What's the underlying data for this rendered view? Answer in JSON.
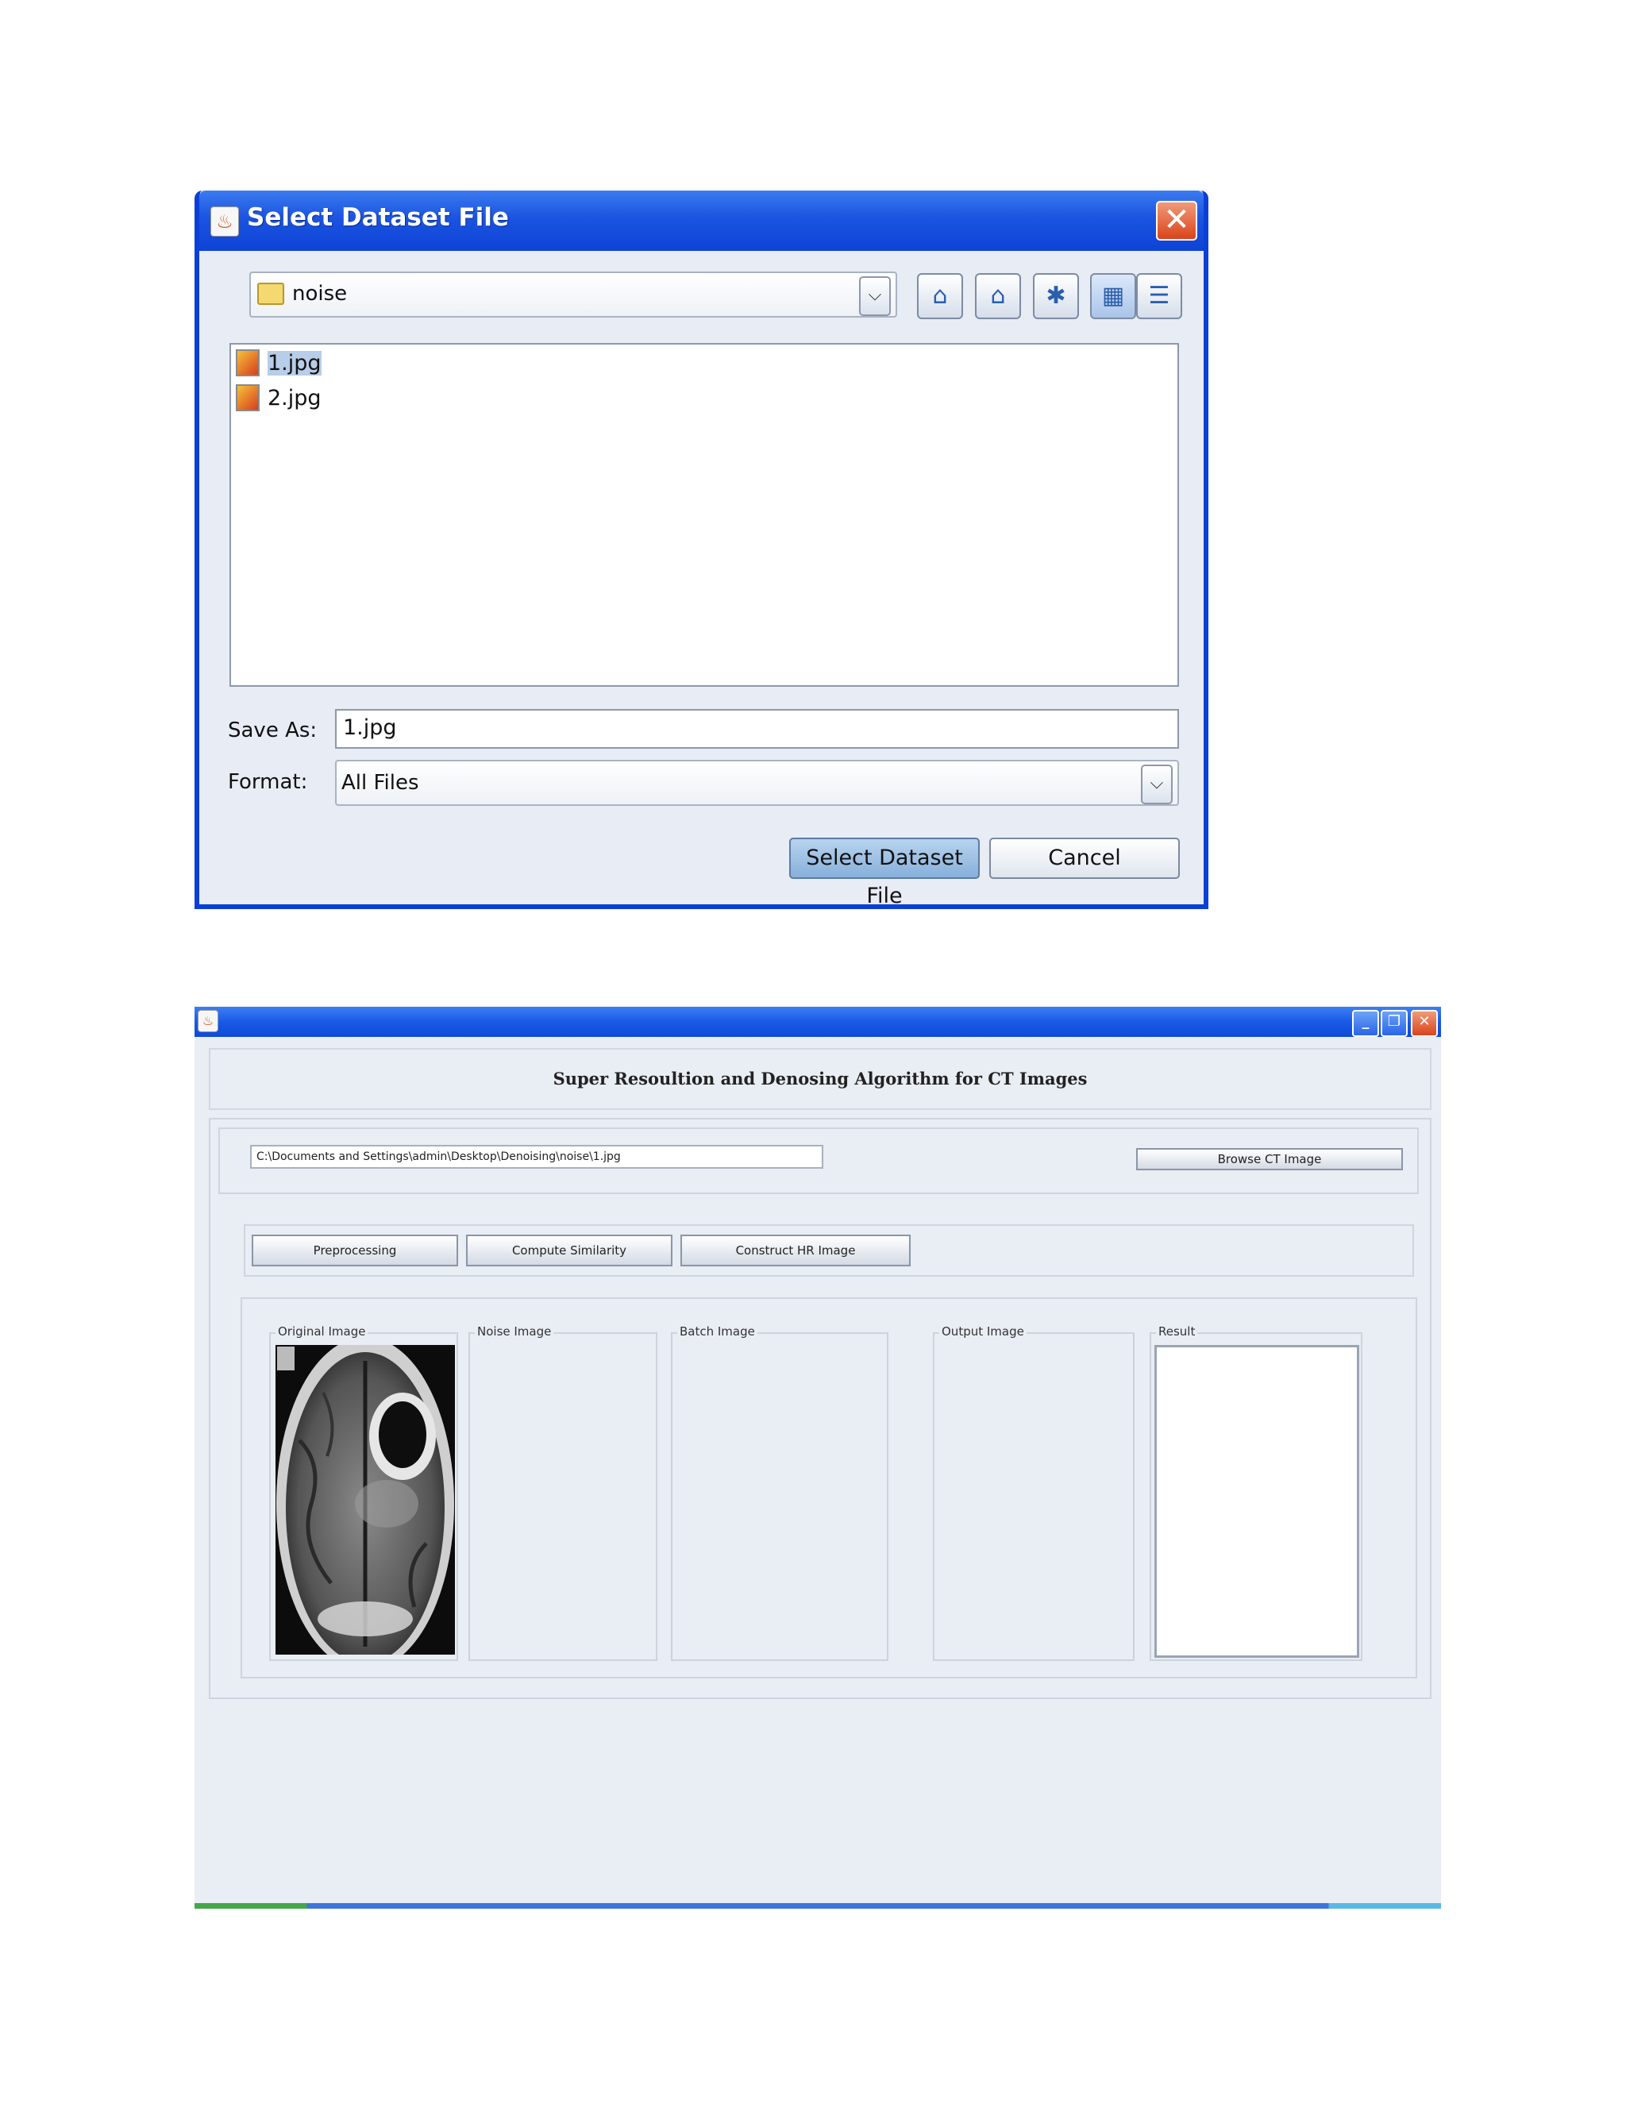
{
  "dialog": {
    "title": "Select Dataset File",
    "close_symbol": "✕",
    "look_in": "noise",
    "toolbar_icons": [
      "up-folder-icon",
      "home-icon",
      "new-folder-icon",
      "list-view-icon",
      "details-view-icon"
    ],
    "files": [
      {
        "name": "1.jpg",
        "selected": true
      },
      {
        "name": "2.jpg",
        "selected": false
      }
    ],
    "save_as_label": "Save As:",
    "save_as_value": "1.jpg",
    "format_label": "Format:",
    "format_value": "All Files",
    "select_button": "Select Dataset File",
    "cancel_button": "Cancel"
  },
  "app": {
    "heading": "Super Resoultion and Denosing Algorithm for CT Images",
    "path_value": "C:\\Documents and Settings\\admin\\Desktop\\Denoising\\noise\\1.jpg",
    "browse_button": "Browse CT Image",
    "buttons": {
      "preprocessing": "Preprocessing",
      "compute_similarity": "Compute Similarity",
      "construct_hr": "Construct HR Image"
    },
    "panels": {
      "original": "Original Image",
      "noise": "Noise Image",
      "batch": "Batch Image",
      "output": "Output Image",
      "result": "Result"
    }
  }
}
